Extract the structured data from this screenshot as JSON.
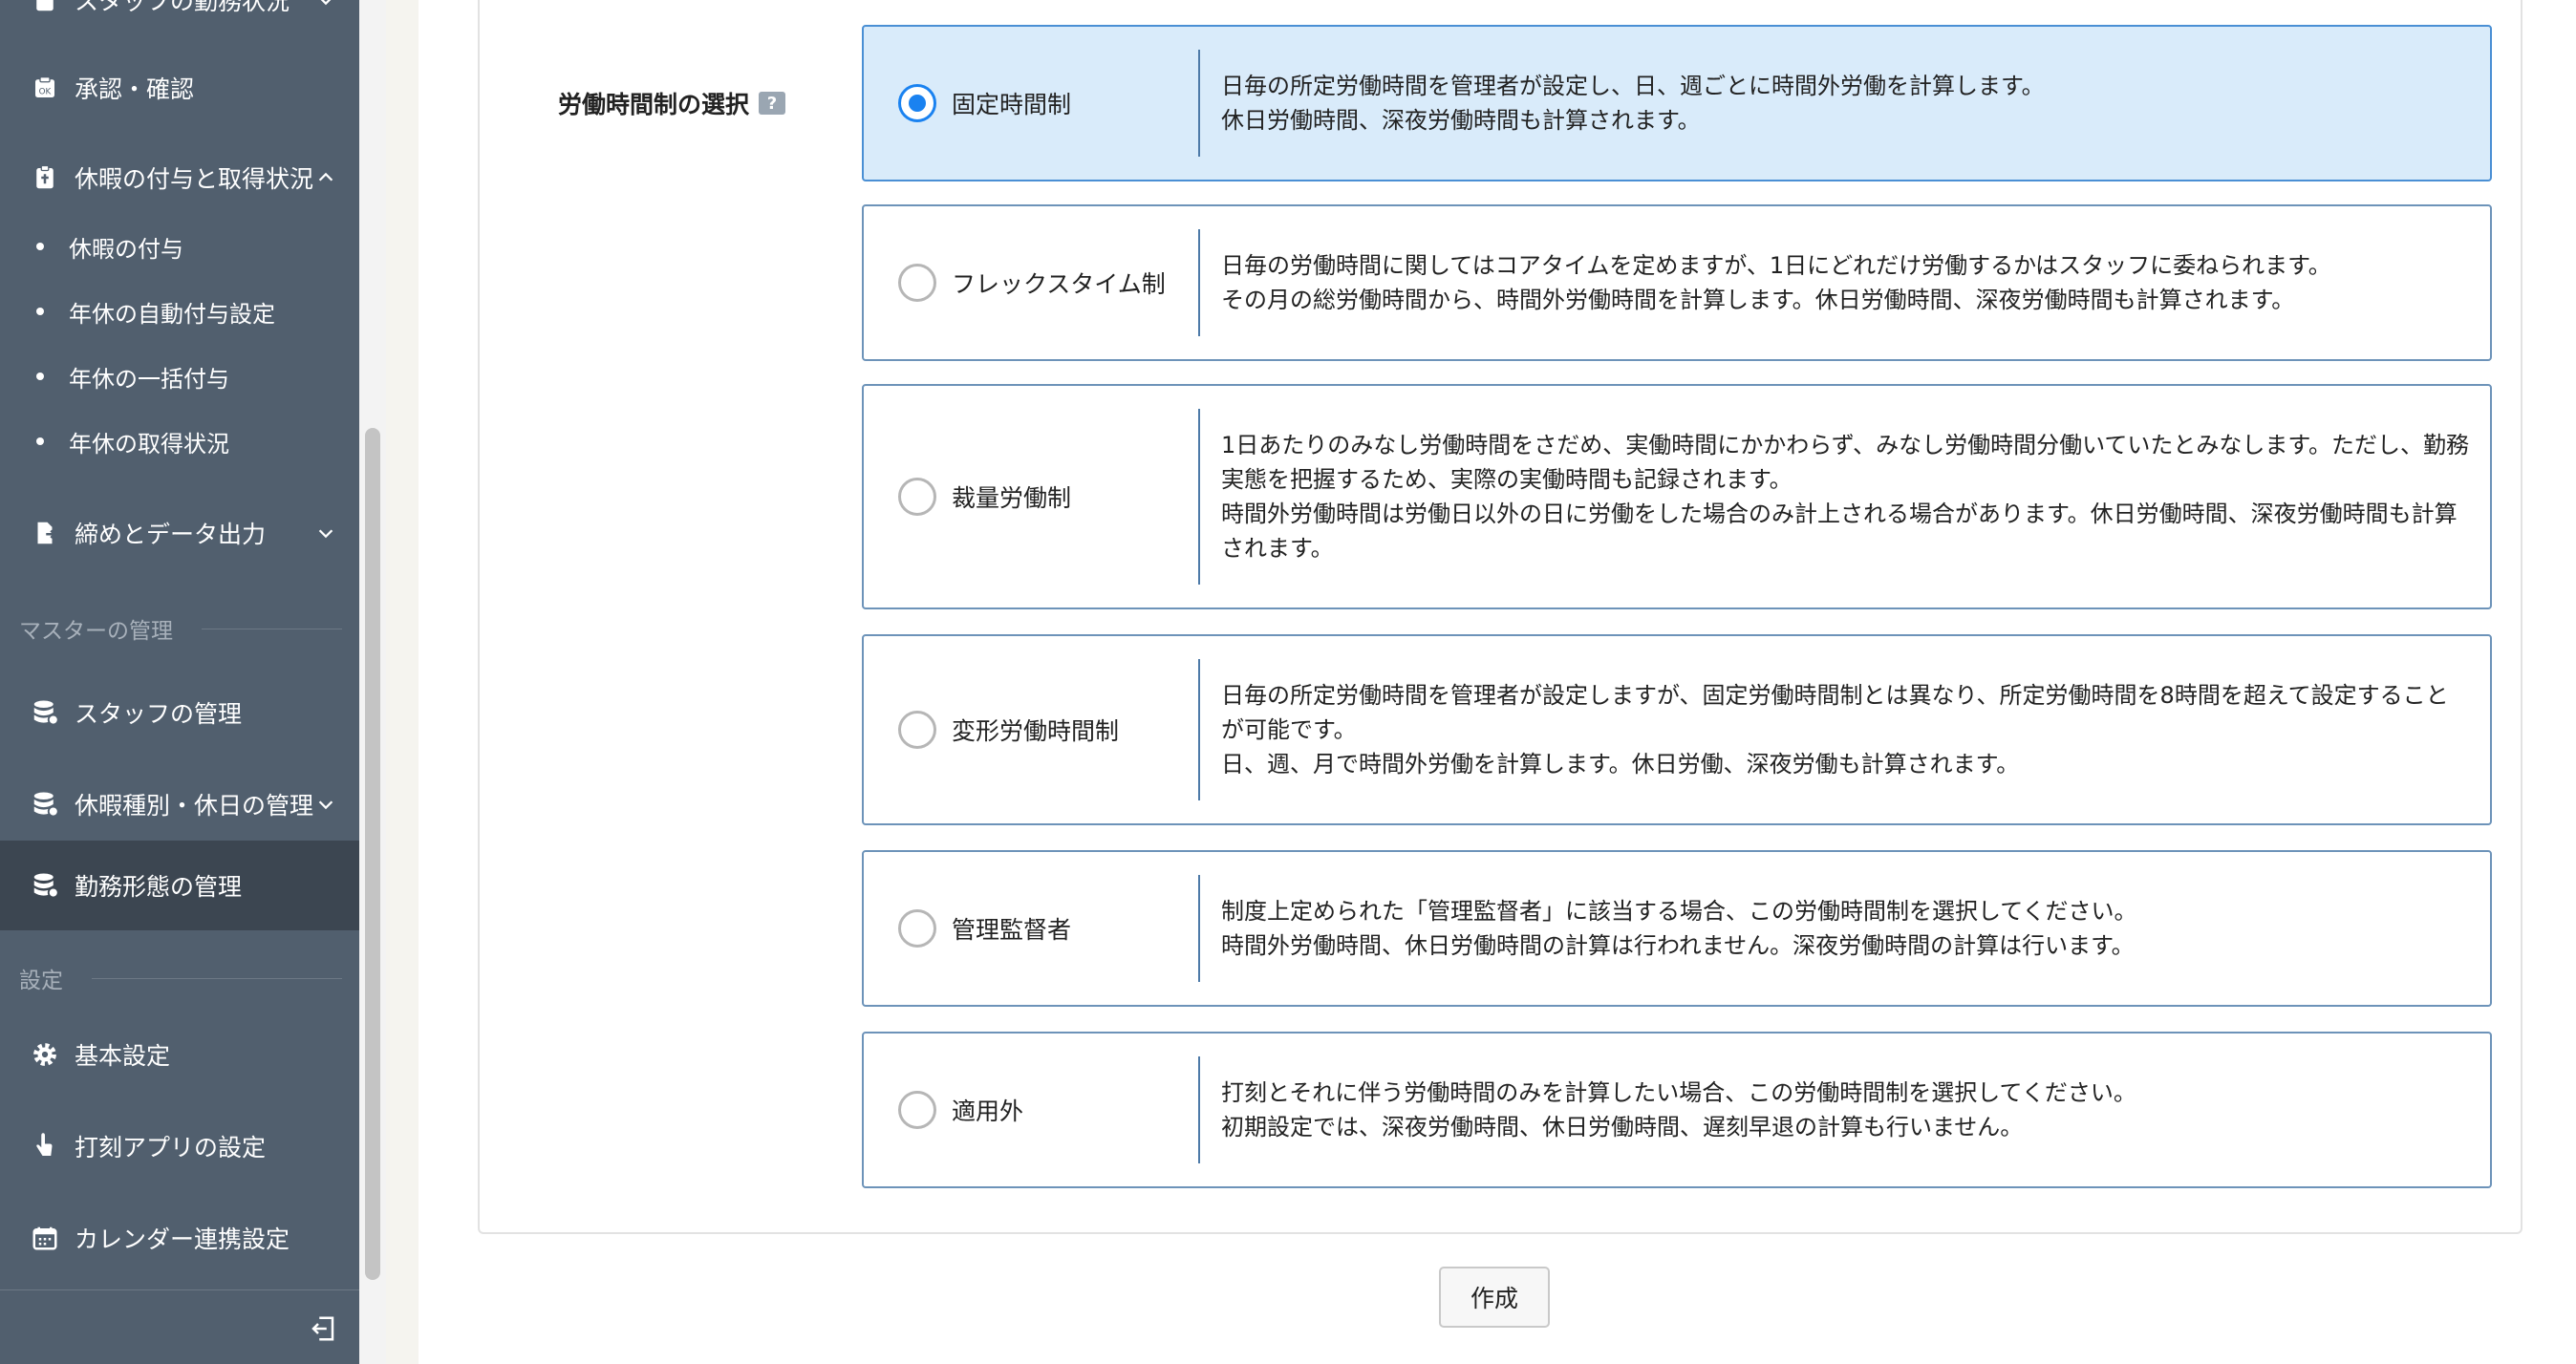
{
  "sidebar": {
    "items": [
      {
        "label": "スタッフの勤務状況",
        "icon": "clipboard-icon"
      },
      {
        "label": "承認・確認",
        "icon": "approval-icon"
      },
      {
        "label": "休暇の付与と取得状況",
        "icon": "leave-icon"
      },
      {
        "label": "締めとデータ出力",
        "icon": "export-icon"
      },
      {
        "label": "スタッフの管理",
        "icon": "database-icon"
      },
      {
        "label": "休暇種別・休日の管理",
        "icon": "database-settings-icon"
      },
      {
        "label": "勤務形態の管理",
        "icon": "database-settings-icon"
      },
      {
        "label": "基本設定",
        "icon": "gear-icon"
      },
      {
        "label": "打刻アプリの設定",
        "icon": "hand-icon"
      },
      {
        "label": "カレンダー連携設定",
        "icon": "calendar-icon"
      }
    ],
    "sub_items": [
      "休暇の付与",
      "年休の自動付与設定",
      "年休の一括付与",
      "年休の取得状況"
    ],
    "sections": {
      "master": "マスターの管理",
      "settings": "設定"
    }
  },
  "form": {
    "label": "労働時間制の選択",
    "help_icon": "?",
    "selected": "固定時間制",
    "options": [
      {
        "label": "固定時間制",
        "lines": [
          "日毎の所定労働時間を管理者が設定し、日、週ごとに時間外労働を計算します。",
          "休日労働時間、深夜労働時間も計算されます。"
        ]
      },
      {
        "label": "フレックスタイム制",
        "lines": [
          "日毎の労働時間に関してはコアタイムを定めますが、1日にどれだけ労働するかはスタッフに委ねられます。",
          "その月の総労働時間から、時間外労働時間を計算します。休日労働時間、深夜労働時間も計算されます。"
        ]
      },
      {
        "label": "裁量労働制",
        "lines": [
          "1日あたりのみなし労働時間をさだめ、実働時間にかかわらず、みなし労働時間分働いていたとみなします。ただし、勤務",
          "実態を把握するため、実際の実働時間も記録されます。",
          "時間外労働時間は労働日以外の日に労働をした場合のみ計上される場合があります。休日労働時間、深夜労働時間も計算",
          "されます。"
        ]
      },
      {
        "label": "変形労働時間制",
        "lines": [
          "日毎の所定労働時間を管理者が設定しますが、固定労働時間制とは異なり、所定労働時間を8時間を超えて設定すること",
          "が可能です。",
          "日、週、月で時間外労働を計算します。休日労働、深夜労働も計算されます。"
        ]
      },
      {
        "label": "管理監督者",
        "lines": [
          "制度上定められた「管理監督者」に該当する場合、この労働時間制を選択してください。",
          "時間外労働時間、休日労働時間の計算は行われません。深夜労働時間の計算は行います。"
        ]
      },
      {
        "label": "適用外",
        "lines": [
          "打刻とそれに伴う労働時間のみを計算したい場合、この労働時間制を選択してください。",
          "初期設定では、深夜労働時間、休日労働時間、遅刻早退の計算も行いません。"
        ]
      }
    ],
    "submit_label": "作成"
  },
  "colors": {
    "sidebar_bg": "#515f6e",
    "sidebar_active": "#3c4651",
    "selected_option_bg": "#d9ebfa",
    "radio_accent": "#1a82f0"
  }
}
